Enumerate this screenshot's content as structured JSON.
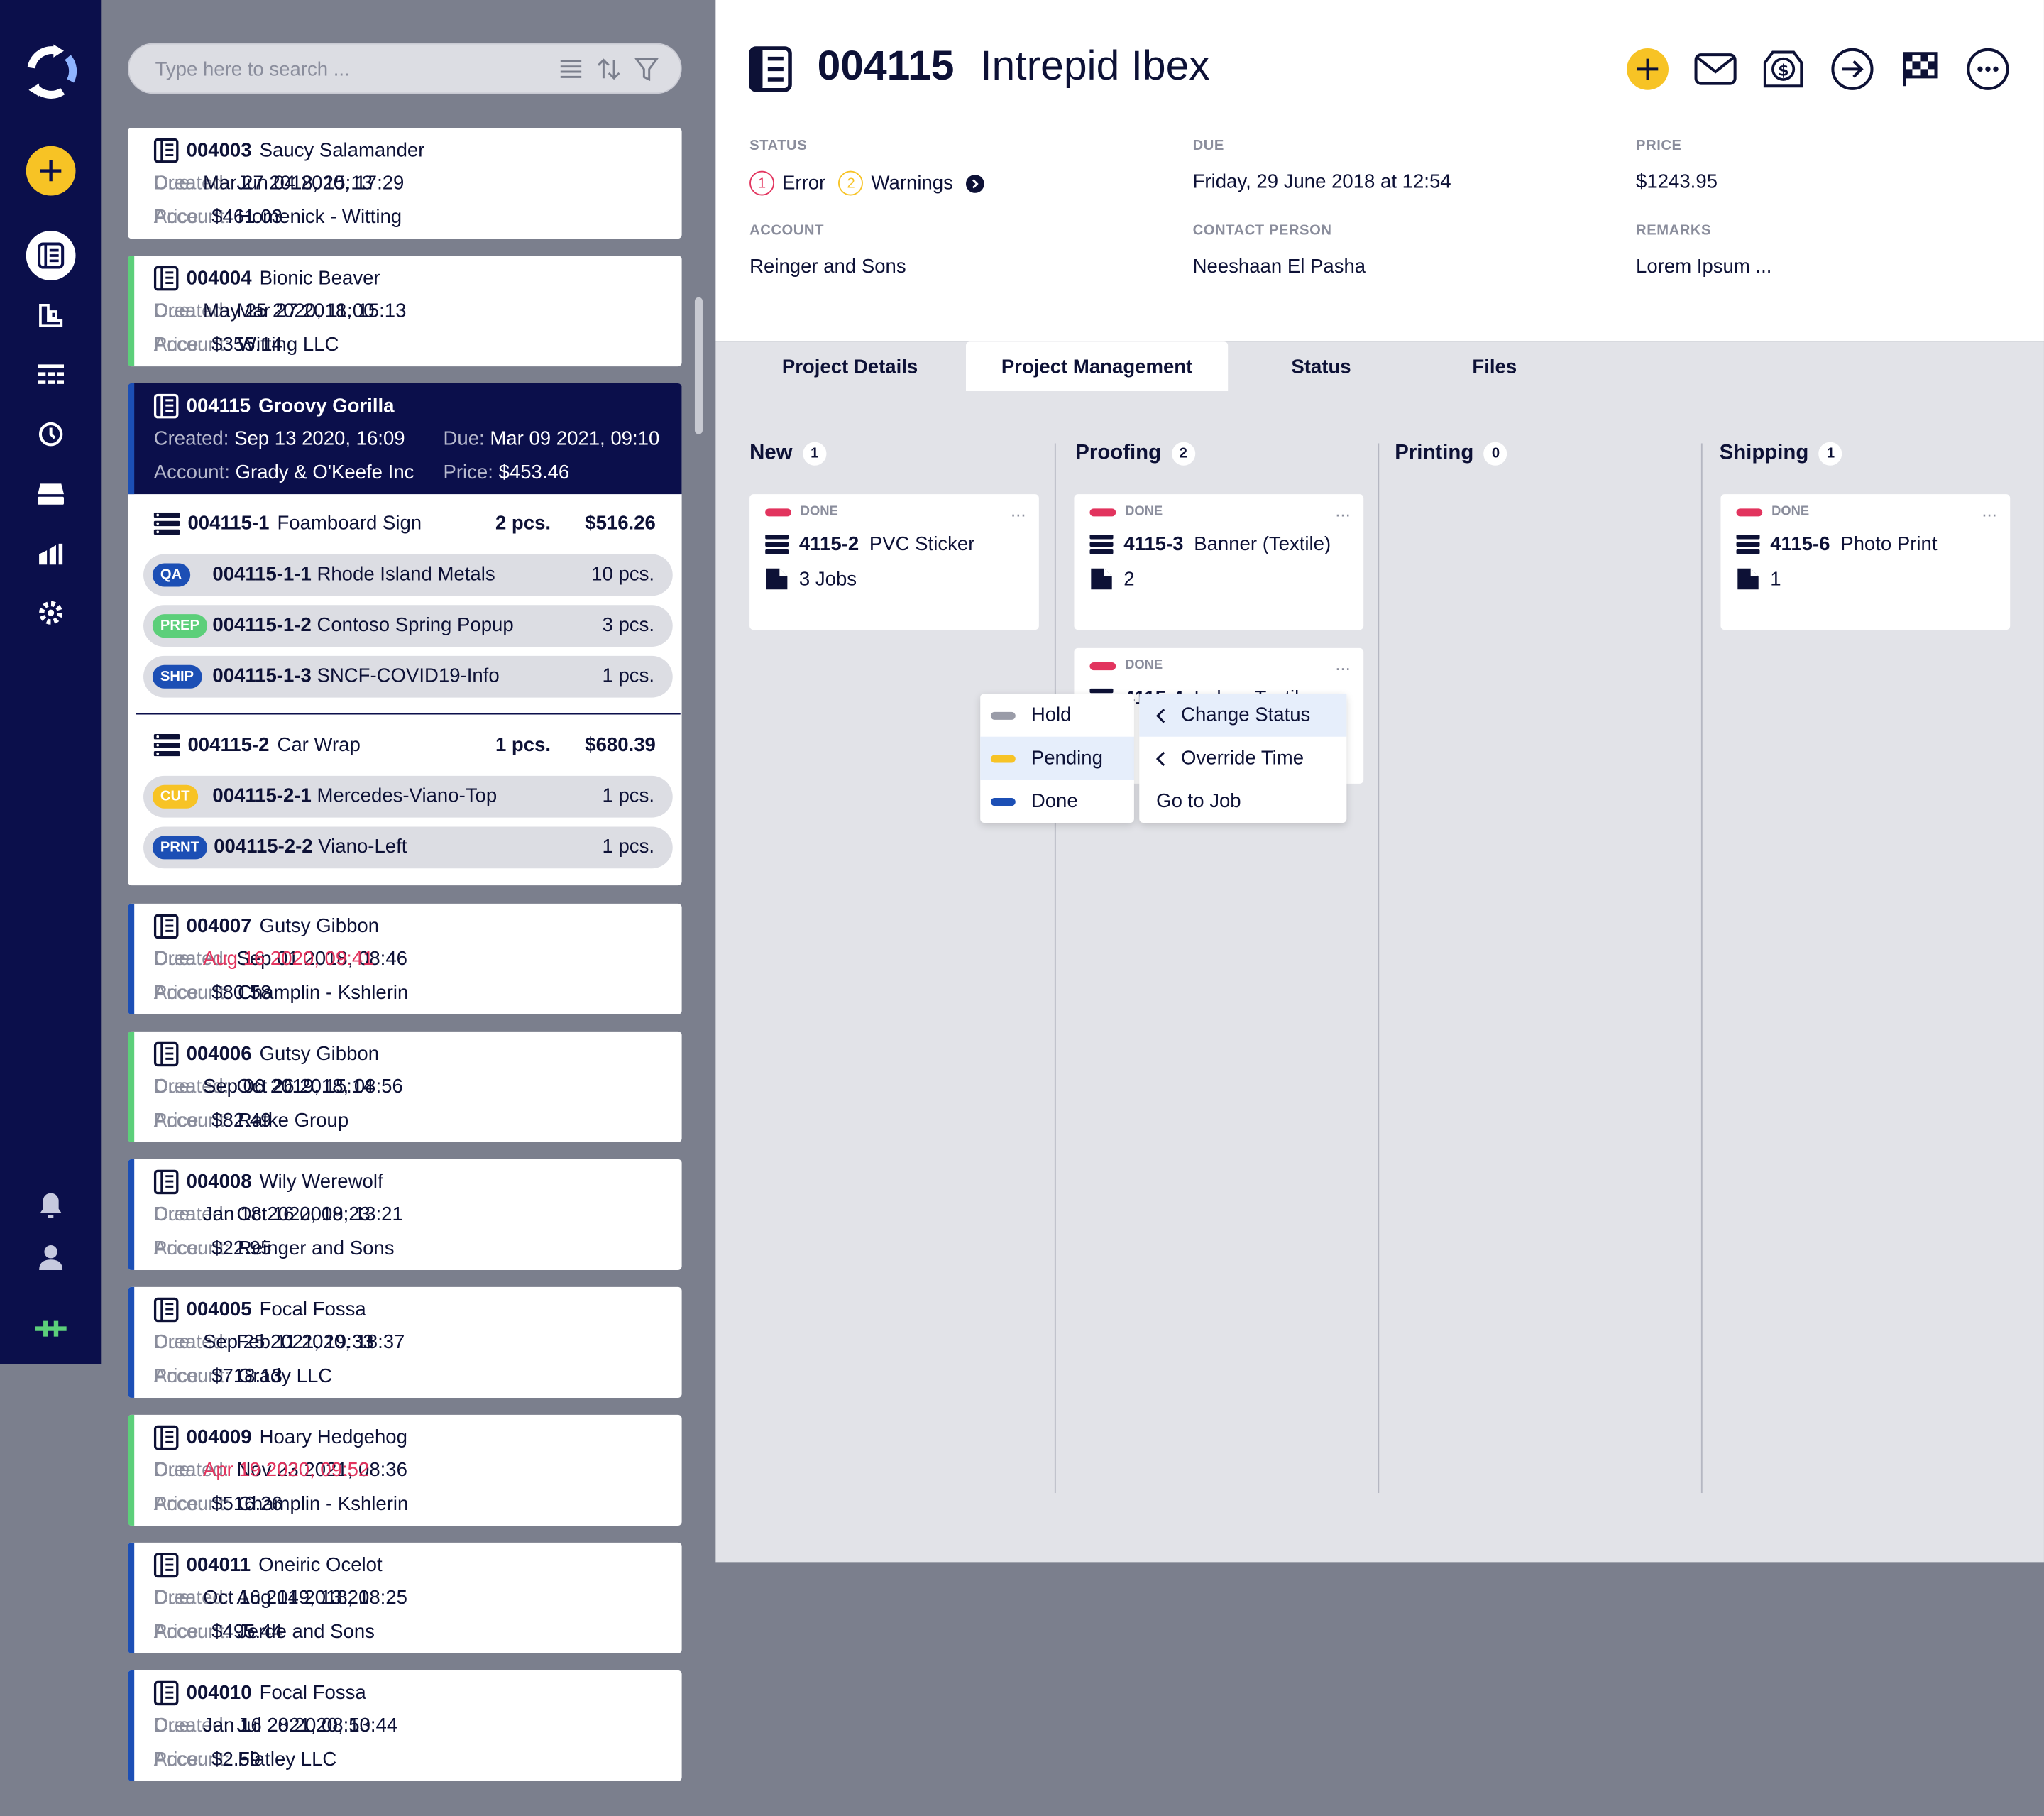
{
  "search": {
    "placeholder": "Type here to search ..."
  },
  "list_cards_top": [
    {
      "id": "004003",
      "name": "Saucy Salamander",
      "created": "Jun 04 2020, 17:29",
      "due": "Mar 27 2018, 15:13",
      "account": "Homenick - Witting",
      "price": "$461.03",
      "bar": "#ffffff",
      "due_overdue": false
    },
    {
      "id": "004004",
      "name": "Bionic Beaver",
      "created": "Mar 27 2018, 15:13",
      "due": "May 25 2020, 11:00",
      "account": "Witting LLC",
      "price": "$355.14",
      "bar": "#5ccf7a",
      "due_overdue": false
    }
  ],
  "labels": {
    "created": "Created:",
    "due": "Due:",
    "account": "Account:",
    "price": "Price:"
  },
  "selected": {
    "id": "004115",
    "name": "Groovy Gorilla",
    "created": "Sep 13 2020, 16:09",
    "due": "Mar 09 2021, 09:10",
    "account": "Grady & O'Keefe Inc",
    "price": "$453.46",
    "items": [
      {
        "id": "004115-1",
        "name": "Foamboard Sign",
        "pcs": "2 pcs.",
        "price": "$516.26",
        "jobs": [
          {
            "tag": "QA",
            "tag_color": "#1c4fb5",
            "id": "004115-1-1",
            "name": "Rhode Island Metals",
            "qty": "10 pcs."
          },
          {
            "tag": "PREP",
            "tag_color": "#5ccf7a",
            "id": "004115-1-2",
            "name": "Contoso Spring Popup",
            "qty": "3 pcs."
          },
          {
            "tag": "SHIP",
            "tag_color": "#1c4fb5",
            "id": "004115-1-3",
            "name": "SNCF-COVID19-Info",
            "qty": "1 pcs."
          }
        ]
      },
      {
        "id": "004115-2",
        "name": "Car Wrap",
        "pcs": "1 pcs.",
        "price": "$680.39",
        "jobs": [
          {
            "tag": "CUT",
            "tag_color": "#f7c325",
            "id": "004115-2-1",
            "name": "Mercedes-Viano-Top",
            "qty": "1 pcs."
          },
          {
            "tag": "PRNT",
            "tag_color": "#1c4fb5",
            "id": "004115-2-2",
            "name": "Viano-Left",
            "qty": "1 pcs."
          }
        ]
      }
    ]
  },
  "list_cards_bottom": [
    {
      "id": "004007",
      "name": "Gutsy Gibbon",
      "created": "Sep 01 2018, 08:46",
      "due": "Aug 16 2020, 09:41",
      "account": "Champlin - Kshlerin",
      "price": "$80.58",
      "bar": "#1c4fb5",
      "due_overdue": true
    },
    {
      "id": "004006",
      "name": "Gutsy Gibbon",
      "created": "Oct 26 2018, 08:56",
      "due": "Sep 06 2019, 15:14",
      "account": "Ratke Group",
      "price": "$82.49",
      "bar": "#5ccf7a",
      "due_overdue": false
    },
    {
      "id": "004008",
      "name": "Wily Werewolf",
      "created": "Oct 16 2019, 13:21",
      "due": "Jan 18 2020, 08:23",
      "account": "Reinger and Sons",
      "price": "$22.95",
      "bar": "#1c4fb5",
      "due_overdue": false
    },
    {
      "id": "004005",
      "name": "Focal Fossa",
      "created": "Feb 11 2020, 18:37",
      "due": "Sep 25 2021, 19:33",
      "account": "Grady LLC",
      "price": "$718.13",
      "bar": "#1c4fb5",
      "due_overdue": false
    },
    {
      "id": "004009",
      "name": "Hoary Hedgehog",
      "created": "Nov 23 2021, 08:36",
      "due": "Apr 19 2020, 09:52",
      "account": "Champlin - Kshlerin",
      "price": "$516.26",
      "bar": "#5ccf7a",
      "due_overdue": true
    },
    {
      "id": "004011",
      "name": "Oneiric Ocelot",
      "created": "Aug 14 2018, 08:25",
      "due": "Oct 16 2019, 13:21",
      "account": "Jerde and Sons",
      "price": "$495.44",
      "bar": "#1c4fb5",
      "due_overdue": false
    },
    {
      "id": "004010",
      "name": "Focal Fossa",
      "created": "Jul 28 2020, 13:44",
      "due": "Jan 16 2021, 08:50",
      "account": "Flatley LLC",
      "price": "$2.59",
      "bar": "#1c4fb5",
      "due_overdue": false
    }
  ],
  "detail": {
    "number": "004115",
    "name": "Intrepid Ibex",
    "status_label": "STATUS",
    "error_count": "1",
    "error_text": "Error",
    "warning_count": "2",
    "warning_text": "Warnings",
    "due_label": "DUE",
    "due_value": "Friday, 29 June 2018 at 12:54",
    "price_label": "PRICE",
    "price_value": "$1243.95",
    "account_label": "ACCOUNT",
    "account_value": "Reinger and Sons",
    "contact_label": "CONTACT PERSON",
    "contact_value": "Neeshaan El Pasha",
    "remarks_label": "REMARKS",
    "remarks_value": "Lorem Ipsum ..."
  },
  "tabs": [
    "Project Details",
    "Project Management",
    "Status",
    "Files"
  ],
  "active_tab": "Project Management",
  "board": {
    "columns": [
      {
        "name": "New",
        "count": "1"
      },
      {
        "name": "Proofing",
        "count": "2"
      },
      {
        "name": "Printing",
        "count": "0"
      },
      {
        "name": "Shipping",
        "count": "1"
      }
    ],
    "cards": {
      "new_1": {
        "status": "DONE",
        "id": "4115-2",
        "name": "PVC Sticker",
        "sub": "3 Jobs"
      },
      "proof_1": {
        "status": "DONE",
        "id": "4115-3",
        "name": "Banner (Textile)",
        "sub": "2"
      },
      "proof_2": {
        "status": "DONE",
        "id": "4115-4",
        "name": "Indoor Textile"
      },
      "ship_1": {
        "status": "DONE",
        "id": "4115-6",
        "name": "Photo Print",
        "sub": "1"
      }
    },
    "dots": "..."
  },
  "context_menu": {
    "items": [
      "Change Status",
      "Override Time",
      "Go to Job"
    ]
  },
  "status_submenu": {
    "items": [
      {
        "label": "Hold",
        "color": "#9a9ca8"
      },
      {
        "label": "Pending",
        "color": "#f7c325"
      },
      {
        "label": "Done",
        "color": "#1c4fb5"
      }
    ]
  },
  "colors": {
    "navy": "#0b0f4b",
    "accent": "#f7c325",
    "error": "#e2345e",
    "green": "#5ccf7a",
    "blue": "#1c4fb5"
  }
}
